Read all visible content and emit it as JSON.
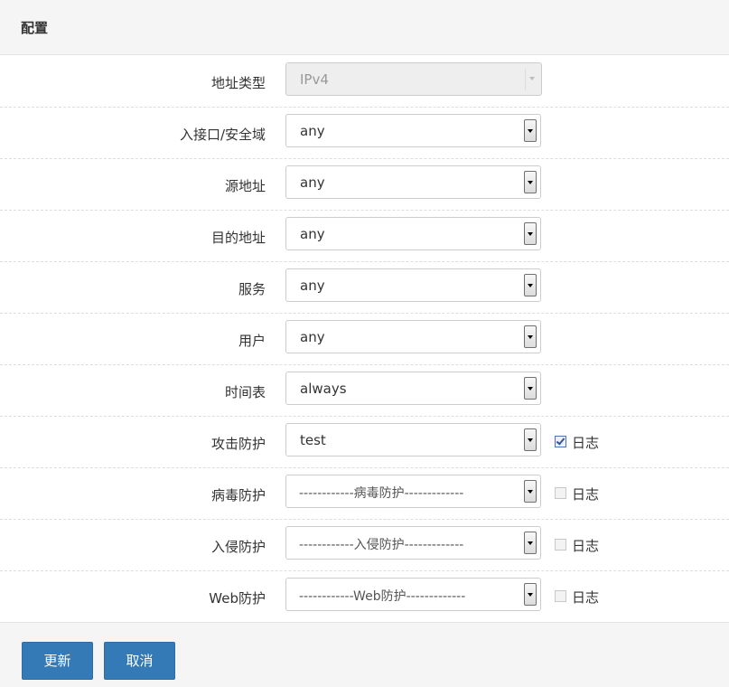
{
  "panel": {
    "title": "配置"
  },
  "fields": [
    {
      "label": "地址类型",
      "value": "IPv4",
      "disabled": true
    },
    {
      "label": "入接口/安全域",
      "value": "any"
    },
    {
      "label": "源地址",
      "value": "any"
    },
    {
      "label": "目的地址",
      "value": "any"
    },
    {
      "label": "服务",
      "value": "any"
    },
    {
      "label": "用户",
      "value": "any"
    },
    {
      "label": "时间表",
      "value": "always"
    },
    {
      "label": "攻击防护",
      "value": "test",
      "log_label": "日志",
      "log_checked": true
    },
    {
      "label": "病毒防护",
      "value": "------------病毒防护-------------",
      "log_label": "日志",
      "log_checked": false
    },
    {
      "label": "入侵防护",
      "value": "------------入侵防护-------------",
      "log_label": "日志",
      "log_checked": false
    },
    {
      "label": "Web防护",
      "value": "------------Web防护-------------",
      "log_label": "日志",
      "log_checked": false
    }
  ],
  "buttons": {
    "update": "更新",
    "cancel": "取消"
  },
  "colors": {
    "primary_button": "#337ab7",
    "header_bg": "#f5f5f5"
  }
}
